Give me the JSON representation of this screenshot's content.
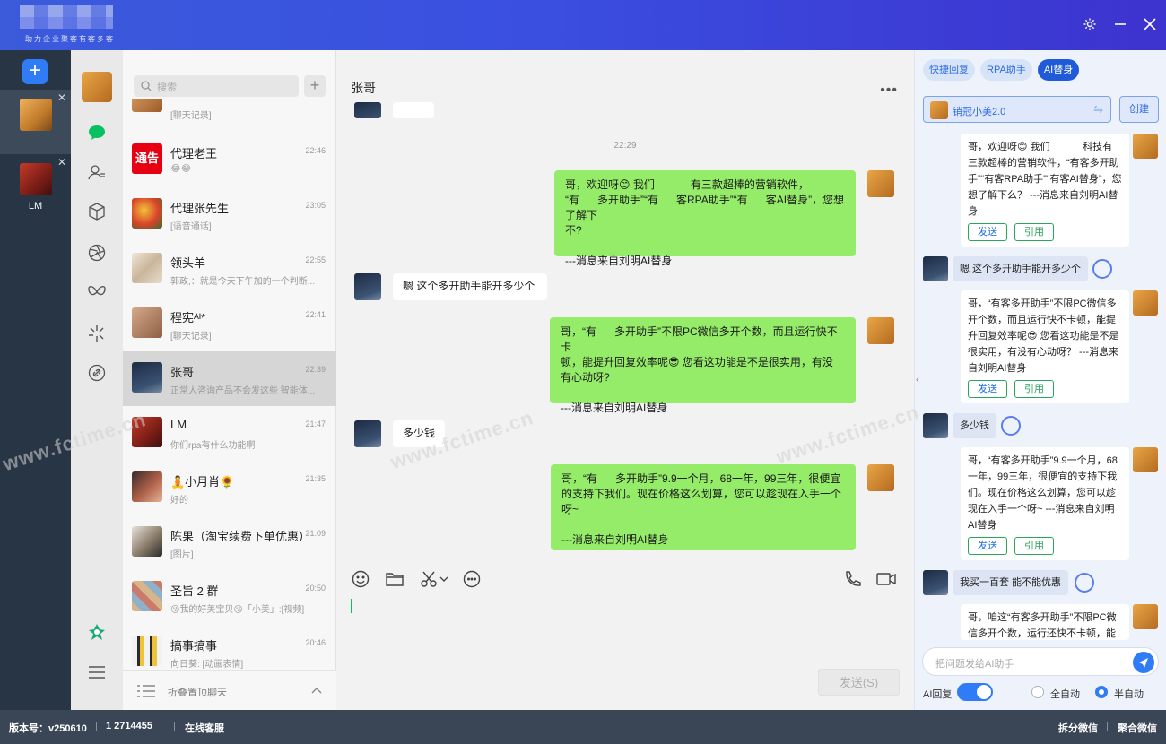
{
  "app": {
    "slogan": "助力企业聚客有客多客",
    "accounts": [
      {
        "name": "",
        "active": true
      },
      {
        "name": "LM",
        "active": false
      }
    ]
  },
  "chat_list": {
    "search_placeholder": "搜索",
    "items": [
      {
        "name": "",
        "time": "",
        "msg": "[聊天记录]"
      },
      {
        "name": "代理老王",
        "time": "22:46",
        "msg": "😂😂"
      },
      {
        "name": "代理张先生",
        "time": "23:05",
        "msg": "[语音通话]"
      },
      {
        "name": "领头羊",
        "time": "22:55",
        "msg": "郭政,：就是今天下午加的一个判断..."
      },
      {
        "name": "程宪ᴬᴵ*",
        "time": "22:41",
        "msg": "[聊天记录]"
      },
      {
        "name": "张哥",
        "time": "22:39",
        "msg": "正常人咨询产品不会发这些 智能体..."
      },
      {
        "name": "LM",
        "time": "21:47",
        "msg": "你们rpa有什么功能啊"
      },
      {
        "name": "🧘小月肖🌻",
        "time": "21:35",
        "msg": "好的"
      },
      {
        "name": "陈果（淘宝续费下单优惠）",
        "time": "21:09",
        "msg": "[图片]"
      },
      {
        "name": "圣旨 2 群",
        "time": "20:50",
        "msg": "😘我的好美宝贝😘「小美」:[视频]"
      },
      {
        "name": "搞事搞事",
        "time": "20:46",
        "msg": "向日葵: [动画表情]"
      }
    ],
    "fold_label": "折叠置顶聊天"
  },
  "chat": {
    "title": "张哥",
    "timestamp": "22:29",
    "messages": [
      {
        "from": "me",
        "text": "哥，欢迎呀😊 我们            有三款超棒的营销软件，\n“有      多开助手”“有      客RPA助手”“有      客AI替身”，您想了解下\n不?\n\n---消息来自刘明AI替身"
      },
      {
        "from": "other",
        "text": "嗯 这个多开助手能开多少个"
      },
      {
        "from": "me",
        "text": "哥，“有      多开助手”不限PC微信多开个数，而且运行快不卡\n顿，能提升回复效率呢😎 您看这功能是不是很实用，有没\n有心动呀?\n\n---消息来自刘明AI替身"
      },
      {
        "from": "other",
        "text": "多少钱"
      },
      {
        "from": "me",
        "text": "哥，“有      多开助手”9.9一个月，68一年，99三年，很便宜\n的支持下我们。现在价格这么划算，您可以趁现在入手一个\n呀~\n\n---消息来自刘明AI替身"
      }
    ],
    "send_label": "发送(S)"
  },
  "ai_panel": {
    "tabs": [
      "快捷回复",
      "RPA助手",
      "AI替身"
    ],
    "bot_name": "销冠小美2.0",
    "create_label": "创建",
    "entries": [
      {
        "type": "answer",
        "text": "哥，欢迎呀😊 我们            科技有三款超棒的营销软件，“有客多开助手”“有客RPA助手”“有客AI替身”，您想了解下么？ ---消息来自刘明AI替身"
      },
      {
        "type": "question",
        "text": "嗯 这个多开助手能开多少个"
      },
      {
        "type": "answer",
        "text": "哥，“有客多开助手”不限PC微信多开个数，而且运行快不卡顿，能提升回复效率呢😎 您看这功能是不是很实用，有没有心动呀？ ---消息来自刘明AI替身"
      },
      {
        "type": "question",
        "text": "多少钱"
      },
      {
        "type": "answer",
        "text": "哥，“有客多开助手”9.9一个月，68一年，99三年，很便宜的支持下我们。现在价格这么划算，您可以趁现在入手一个呀~ ---消息来自刘明AI替身"
      },
      {
        "type": "question",
        "text": "我买一百套 能不能优惠"
      },
      {
        "type": "answer",
        "text": "哥，咱这“有客多开助手”不限PC微信多开个数，运行还快不卡顿，能"
      }
    ],
    "send_btn": "发送",
    "quote_btn": "引用",
    "ask_placeholder": "把问题发给AI助手",
    "ai_reply_label": "AI回复",
    "ai_reply_on": true,
    "mode_full": "全自动",
    "mode_semi": "半自动",
    "mode_selected": "半自动"
  },
  "status_bar": {
    "version": "版本号：v250610",
    "phone": "1      2714455",
    "service": "在线客服",
    "split": "拆分微信",
    "merge": "聚合微信"
  },
  "watermark": "www.fctime.cn",
  "colors": {
    "accent": "#2f7cf6",
    "my_bubble": "#95ec69",
    "topbar": "#3b4fe0"
  }
}
